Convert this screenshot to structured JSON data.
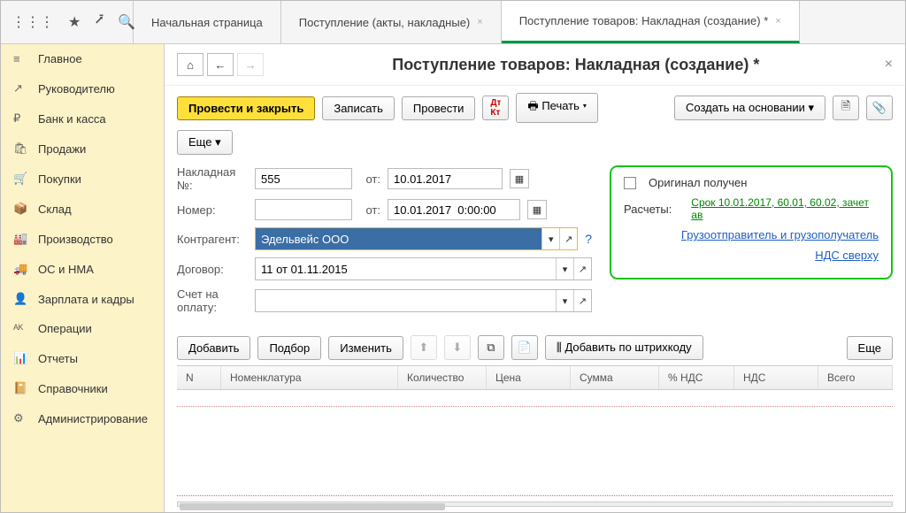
{
  "tabs": [
    {
      "label": "Начальная страница"
    },
    {
      "label": "Поступление (акты, накладные)"
    },
    {
      "label": "Поступление товаров: Накладная (создание) *",
      "active": true
    }
  ],
  "nav": [
    {
      "icon": "≡",
      "label": "Главное"
    },
    {
      "icon": "↗",
      "label": "Руководителю"
    },
    {
      "icon": "₽",
      "label": "Банк и касса"
    },
    {
      "icon": "🛍",
      "label": "Продажи"
    },
    {
      "icon": "🛒",
      "label": "Покупки"
    },
    {
      "icon": "📦",
      "label": "Склад"
    },
    {
      "icon": "🏭",
      "label": "Производство"
    },
    {
      "icon": "🚚",
      "label": "ОС и НМА"
    },
    {
      "icon": "👤",
      "label": "Зарплата и кадры"
    },
    {
      "icon": "ᴬᴷ",
      "label": "Операции"
    },
    {
      "icon": "📊",
      "label": "Отчеты"
    },
    {
      "icon": "📔",
      "label": "Справочники"
    },
    {
      "icon": "⚙",
      "label": "Администрирование"
    }
  ],
  "page_title": "Поступление товаров: Накладная (создание) *",
  "toolbar": {
    "post_close": "Провести и закрыть",
    "save": "Записать",
    "post": "Провести",
    "print": "Печать",
    "create_based": "Создать на основании",
    "more": "Еще"
  },
  "form": {
    "invoice_no_label": "Накладная №:",
    "invoice_no": "555",
    "from": "от:",
    "date1": "10.01.2017",
    "number_label": "Номер:",
    "number": "",
    "date2": "10.01.2017  0:00:00",
    "counterparty_label": "Контрагент:",
    "counterparty": "Эдельвейс ООО",
    "contract_label": "Договор:",
    "contract": "11 от 01.11.2015",
    "bill_label": "Счет на оплату:"
  },
  "right": {
    "original": "Оригинал получен",
    "calc_label": "Расчеты:",
    "calc_link": "Срок 10.01.2017, 60.01, 60.02, зачет ав",
    "shipper_link": "Грузоотправитель и грузополучатель",
    "vat_link": "НДС сверху"
  },
  "table_toolbar": {
    "add": "Добавить",
    "pick": "Подбор",
    "edit": "Изменить",
    "barcode": "Добавить по штрихкоду",
    "more": "Еще"
  },
  "table_cols": [
    "N",
    "Номенклатура",
    "Количество",
    "Цена",
    "Сумма",
    "% НДС",
    "НДС",
    "Всего"
  ]
}
